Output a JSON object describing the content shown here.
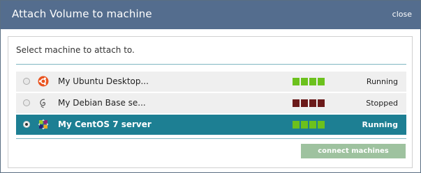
{
  "dialog": {
    "title": "Attach Volume to machine",
    "close_label": "close",
    "prompt": "Select machine to attach to.",
    "connect_label": "connect machines"
  },
  "machines": [
    {
      "name": "My Ubuntu Desktop...",
      "status": "Running",
      "os_icon": "ubuntu-icon",
      "selected": false
    },
    {
      "name": "My Debian Base se...",
      "status": "Stopped",
      "os_icon": "debian-icon",
      "selected": false
    },
    {
      "name": "My CentOS 7 server",
      "status": "Running",
      "os_icon": "centos-icon",
      "selected": true
    }
  ],
  "colors": {
    "titlebar": "#546d8e",
    "selected_row": "#1d7f93",
    "running": "#6cc11d",
    "stopped": "#6b1a1a",
    "connect_button": "#9ec29f"
  }
}
